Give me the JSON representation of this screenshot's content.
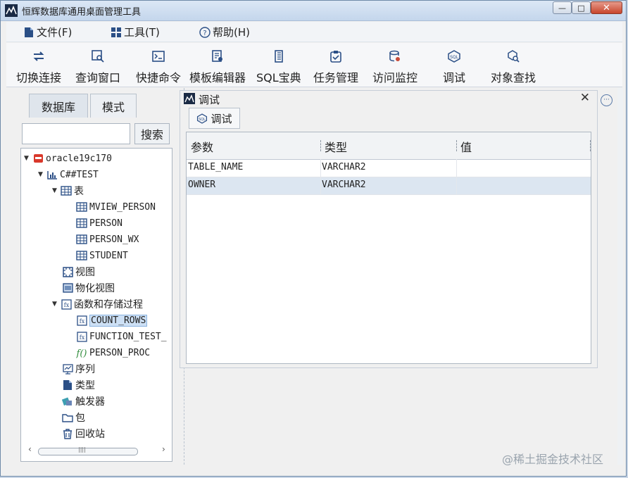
{
  "window": {
    "title": "恒辉数据库通用桌面管理工具",
    "minimize": "—",
    "maximize": "□",
    "close": "✕"
  },
  "menu": [
    {
      "label": "文件(F)",
      "icon": "file-icon"
    },
    {
      "label": "工具(T)",
      "icon": "tools-icon"
    },
    {
      "label": "帮助(H)",
      "icon": "help-icon"
    }
  ],
  "toolbar": [
    {
      "label": "切换连接",
      "icon": "switch-connection-icon"
    },
    {
      "label": "查询窗口",
      "icon": "query-window-icon"
    },
    {
      "label": "快捷命令",
      "icon": "shortcut-command-icon"
    },
    {
      "label": "模板编辑器",
      "icon": "template-editor-icon"
    },
    {
      "label": "SQL宝典",
      "icon": "sql-book-icon"
    },
    {
      "label": "任务管理",
      "icon": "task-management-icon"
    },
    {
      "label": "访问监控",
      "icon": "access-monitor-icon"
    },
    {
      "label": "调试",
      "icon": "debug-icon"
    },
    {
      "label": "对象查找",
      "icon": "object-search-icon"
    }
  ],
  "left_panel": {
    "tabs": [
      "数据库",
      "模式"
    ],
    "search_placeholder": "",
    "search_button": "搜索",
    "tree": [
      {
        "label": "oracle19c170",
        "level": 0,
        "icon": "database-icon",
        "expanded": true
      },
      {
        "label": "C##TEST",
        "level": 1,
        "icon": "schema-icon",
        "expanded": true
      },
      {
        "label": "表",
        "level": 2,
        "icon": "table-icon",
        "expanded": true
      },
      {
        "label": "MVIEW_PERSON",
        "level": 3,
        "icon": "table-icon"
      },
      {
        "label": "PERSON",
        "level": 3,
        "icon": "table-icon"
      },
      {
        "label": "PERSON_WX",
        "level": 3,
        "icon": "table-icon"
      },
      {
        "label": "STUDENT",
        "level": 3,
        "icon": "table-icon"
      },
      {
        "label": "视图",
        "level": 2,
        "icon": "view-icon"
      },
      {
        "label": "物化视图",
        "level": 2,
        "icon": "materialized-view-icon"
      },
      {
        "label": "函数和存储过程",
        "level": 2,
        "icon": "function-icon",
        "expanded": true
      },
      {
        "label": "COUNT_ROWS",
        "level": 3,
        "icon": "function-icon",
        "selected": true
      },
      {
        "label": "FUNCTION_TEST_",
        "level": 3,
        "icon": "function-icon"
      },
      {
        "label": "PERSON_PROC",
        "level": 3,
        "icon": "procedure-icon"
      },
      {
        "label": "序列",
        "level": 2,
        "icon": "sequence-icon"
      },
      {
        "label": "类型",
        "level": 2,
        "icon": "type-icon"
      },
      {
        "label": "触发器",
        "level": 2,
        "icon": "trigger-icon"
      },
      {
        "label": "包",
        "level": 2,
        "icon": "package-icon"
      },
      {
        "label": "回收站",
        "level": 2,
        "icon": "recycle-bin-icon"
      }
    ],
    "scroll_grip": "||||"
  },
  "debug_panel": {
    "title": "调试",
    "close": "✕",
    "tab_label": "调试",
    "columns": [
      "参数",
      "类型",
      "值"
    ],
    "rows": [
      [
        "TABLE_NAME",
        "VARCHAR2",
        ""
      ],
      [
        "OWNER",
        "VARCHAR2",
        ""
      ]
    ]
  },
  "more_button": "···",
  "watermark": "@稀土掘金技术社区",
  "colors": {
    "accent": "#2b5aa0",
    "selected_row": "#dce6f1",
    "title_bar": "#c4d6ec"
  }
}
